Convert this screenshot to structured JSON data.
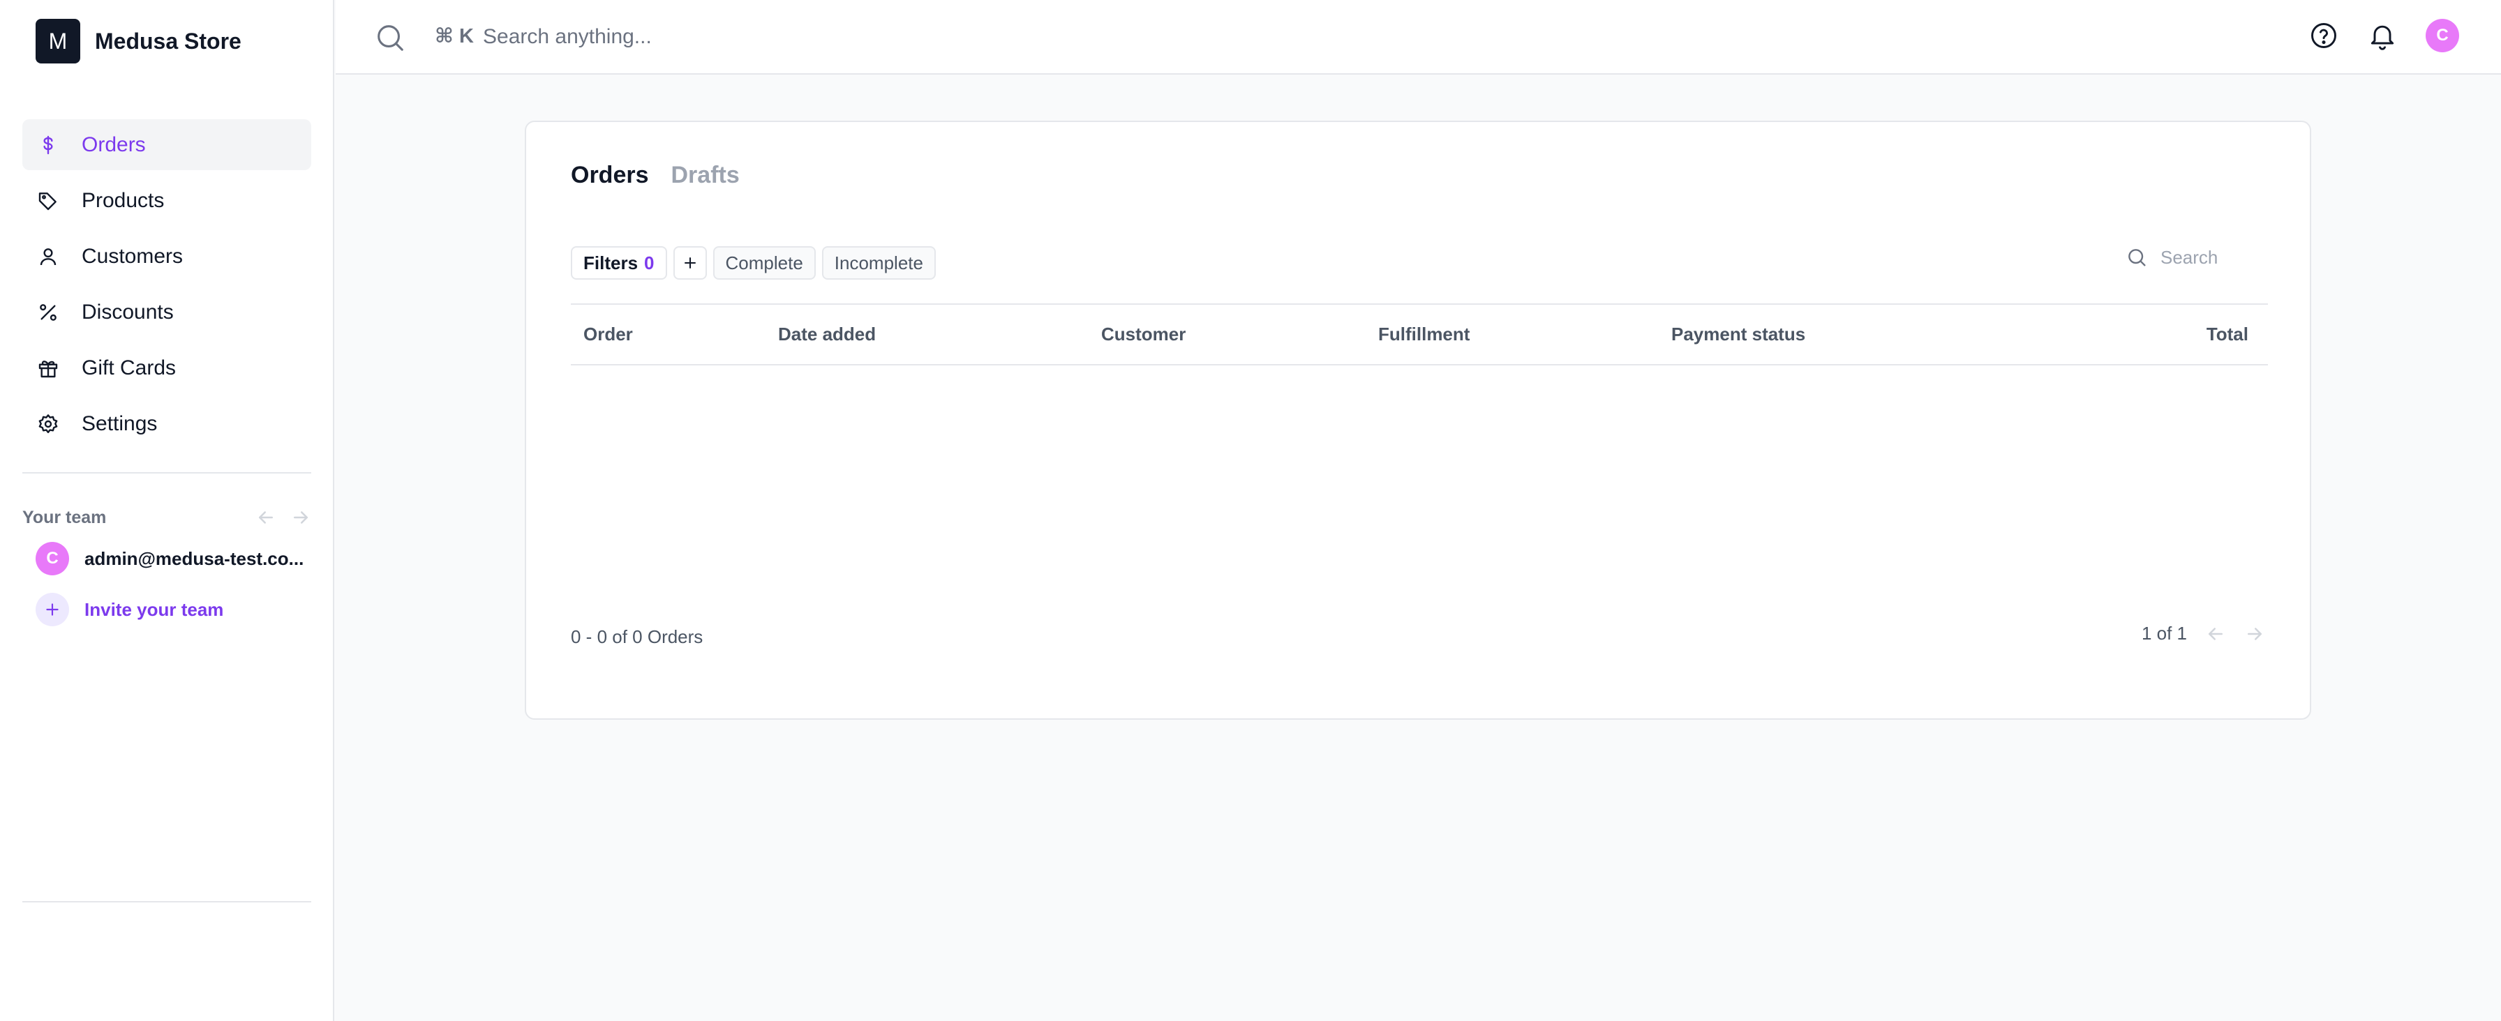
{
  "store": {
    "logo_letter": "M",
    "name": "Medusa Store"
  },
  "nav": {
    "items": [
      {
        "label": "Orders",
        "icon": "dollar-icon",
        "active": true
      },
      {
        "label": "Products",
        "icon": "tag-icon"
      },
      {
        "label": "Customers",
        "icon": "user-icon"
      },
      {
        "label": "Discounts",
        "icon": "percent-icon"
      },
      {
        "label": "Gift Cards",
        "icon": "gift-icon"
      },
      {
        "label": "Settings",
        "icon": "gear-icon"
      }
    ]
  },
  "team": {
    "title": "Your team",
    "member": {
      "initial": "C",
      "email": "admin@medusa-test.co..."
    },
    "invite_label": "Invite your team"
  },
  "topbar": {
    "shortcut": "⌘ K",
    "search_placeholder": "Search anything...",
    "avatar_initial": "C"
  },
  "orders": {
    "tabs": [
      {
        "label": "Orders",
        "active": true
      },
      {
        "label": "Drafts",
        "active": false
      }
    ],
    "filters": {
      "label": "Filters",
      "count": "0",
      "quick": [
        "Complete",
        "Incomplete"
      ]
    },
    "search_placeholder": "Search",
    "columns": [
      "Order",
      "Date added",
      "Customer",
      "Fulfillment",
      "Payment status",
      "Total"
    ],
    "rows": [],
    "count_text": "0 - 0 of 0 Orders",
    "page_text": "1 of 1"
  },
  "colors": {
    "accent": "#7C3AED",
    "avatar": "#E879F9",
    "sidebar_active_bg": "#F3F4F6"
  }
}
